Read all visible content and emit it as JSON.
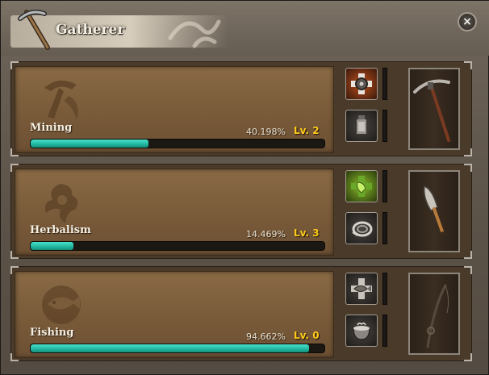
{
  "window": {
    "title": "Gatherer",
    "close_icon": "×"
  },
  "skills": [
    {
      "name": "Mining",
      "progress_text": "40.198%",
      "progress": 40.198,
      "level_text": "Lv. 2",
      "emblem": "pickaxe-emblem-icon",
      "slots": [
        "cogwheel-plus-icon",
        "lantern-icon"
      ],
      "tool": "pickaxe-icon"
    },
    {
      "name": "Herbalism",
      "progress_text": "14.469%",
      "progress": 14.469,
      "level_text": "Lv. 3",
      "emblem": "herb-emblem-icon",
      "slots": [
        "leaf-plus-icon",
        "rope-coil-icon"
      ],
      "tool": "trowel-icon"
    },
    {
      "name": "Fishing",
      "progress_text": "94.662%",
      "progress": 94.662,
      "level_text": "Lv. 0",
      "emblem": "fish-emblem-icon",
      "slots": [
        "fish-plus-icon",
        "cauldron-icon"
      ],
      "tool": "fishing-rod-icon"
    }
  ],
  "colors": {
    "progress_fill": "#1fb59e",
    "level_text": "#ffcc1a",
    "panel": "#7a5c3a"
  }
}
